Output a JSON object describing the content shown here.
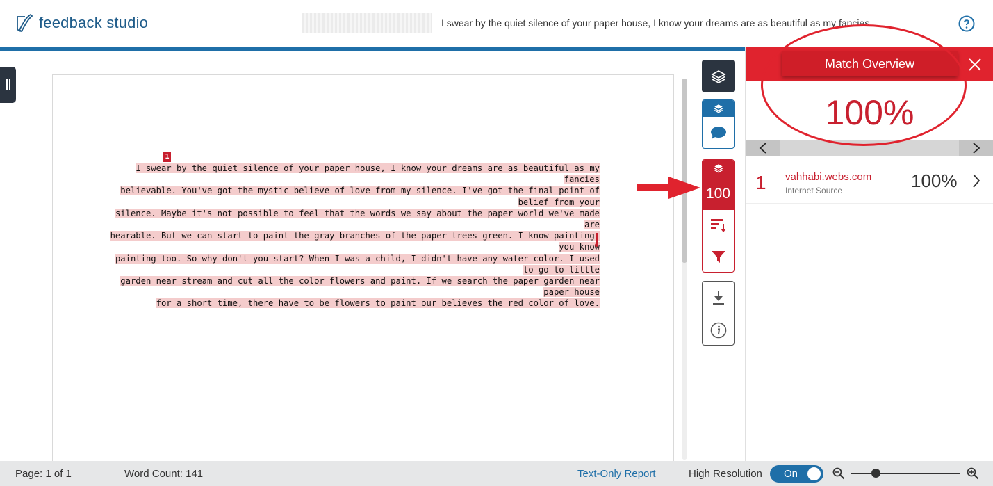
{
  "app": {
    "logo_text": "feedback studio",
    "doc_title": "I swear by the quiet silence of your paper house, I know your dreams are as beautiful as my fancies..."
  },
  "document": {
    "match_marker": "1",
    "lines": [
      "I swear by the quiet silence of your paper house, I know your dreams are as beautiful as my fancies",
      "believable. You've got the mystic believe of love from my silence. I've got the final point of belief from your",
      "silence. Maybe it's not possible to feel that the words we say about the paper world we've made are",
      "hearable. But we can start to paint the gray branches of the paper trees green. I know painting, you know",
      "painting too. So why don't you start? When I was a child, I didn't have any water color. I used to go to little",
      "garden near stream and cut all the color flowers and paint. If we search the paper garden near paper house",
      "for a short time, there have to be flowers to paint our believes the red color of love."
    ]
  },
  "toolbar": {
    "similarity_score": "100"
  },
  "panel": {
    "title": "Match Overview",
    "overall_score": "100%",
    "matches": [
      {
        "number": "1",
        "source": "vahhabi.webs.com",
        "type": "Internet Source",
        "percent": "100%"
      }
    ]
  },
  "footer": {
    "page": "Page: 1 of 1",
    "word_count": "Word Count: 141",
    "text_only_report": "Text-Only Report",
    "high_resolution": "High Resolution",
    "toggle_state": "On",
    "zoom_level": 0.23
  },
  "colors": {
    "brand_blue": "#1f6fa8",
    "match_red": "#c8202f",
    "highlight": "#f4cccc",
    "dark": "#2b3440"
  }
}
